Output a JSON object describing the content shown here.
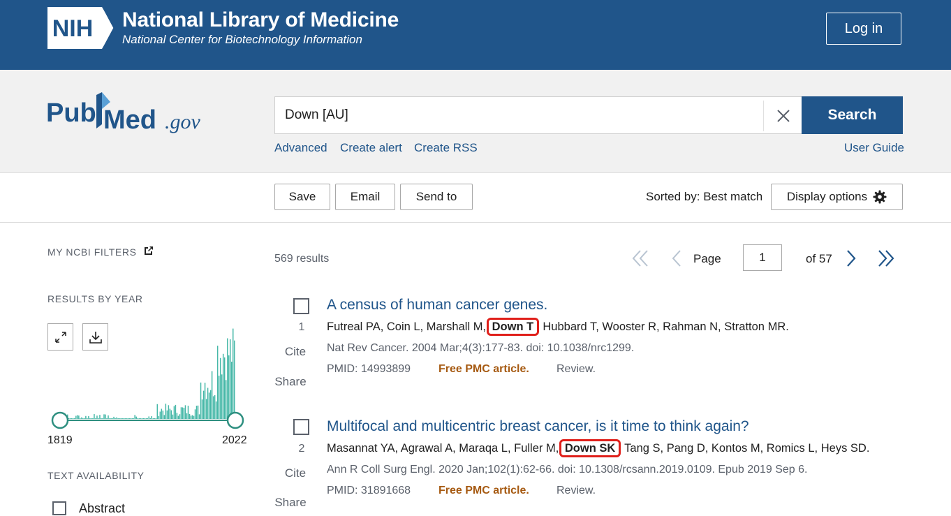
{
  "banner": {
    "logo_text": "NIH",
    "title": "National Library of Medicine",
    "subtitle": "National Center for Biotechnology Information",
    "login": "Log in",
    "bg_color": "#20558a"
  },
  "search": {
    "logo_text": "PubMed.gov",
    "query": "Down [AU]",
    "clear_icon": "close-icon",
    "button": "Search",
    "links": {
      "advanced": "Advanced",
      "create_alert": "Create alert",
      "create_rss": "Create RSS",
      "user_guide": "User Guide"
    }
  },
  "actions": {
    "save": "Save",
    "email": "Email",
    "send_to": "Send to",
    "sorted_by": "Sorted by: Best match",
    "display_options": "Display options",
    "display_icon": "gear-icon"
  },
  "sidebar": {
    "my_filters": "MY NCBI FILTERS",
    "results_by_year": "RESULTS BY YEAR",
    "expand_icon": "expand-icon",
    "download_icon": "download-icon",
    "year_start": "1819",
    "year_end": "2022",
    "text_availability": "TEXT AVAILABILITY",
    "abstract_label": "Abstract",
    "accent_color": "#47b8a8"
  },
  "results": {
    "count": "569 results",
    "page_label": "Page",
    "page_value": "1",
    "of_label": "of 57",
    "items": [
      {
        "num": "1",
        "cite": "Cite",
        "share": "Share",
        "title": "A census of human cancer genes.",
        "authors_before": "Futreal PA, Coin L, Marshall M,",
        "highlight": "Down T",
        "authors_after": ", Hubbard T, Wooster R, Rahman N, Stratton MR.",
        "citation": "Nat Rev Cancer. 2004 Mar;4(3):177-83. doi: 10.1038/nrc1299.",
        "pmid": "PMID: 14993899",
        "free": "Free PMC article.",
        "type": "Review."
      },
      {
        "num": "2",
        "cite": "Cite",
        "share": "Share",
        "title": "Multifocal and multicentric breast cancer, is it time to think again?",
        "authors_before": "Masannat YA, Agrawal A, Maraqa L, Fuller M,",
        "highlight": "Down SK",
        "authors_after": ", Tang S, Pang D, Kontos M, Romics L, Heys SD.",
        "citation": "Ann R Coll Surg Engl. 2020 Jan;102(1):62-66. doi: 10.1308/rcsann.2019.0109. Epub 2019 Sep 6.",
        "pmid": "PMID: 31891668",
        "free": "Free PMC article.",
        "type": "Review."
      }
    ]
  }
}
